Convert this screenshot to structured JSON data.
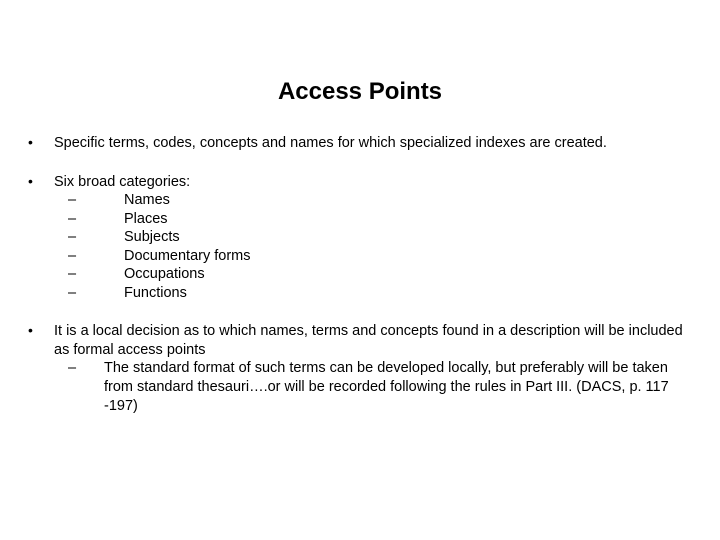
{
  "title": "Access Points",
  "bullets": {
    "b1": "Specific terms, codes, concepts and names for which specialized indexes are created.",
    "b2": {
      "lead": "Six broad categories:",
      "items": [
        "Names",
        "Places",
        "Subjects",
        "Documentary forms",
        "Occupations",
        "Functions"
      ]
    },
    "b3": {
      "lead": "It is a local decision as to which names, terms and concepts found in a description will be included as formal access points",
      "sub": "The standard format of such terms can be developed locally, but preferably will be taken from standard thesauri….or will be recorded following the rules in Part III. (DACS, p. 117 -197)"
    }
  }
}
